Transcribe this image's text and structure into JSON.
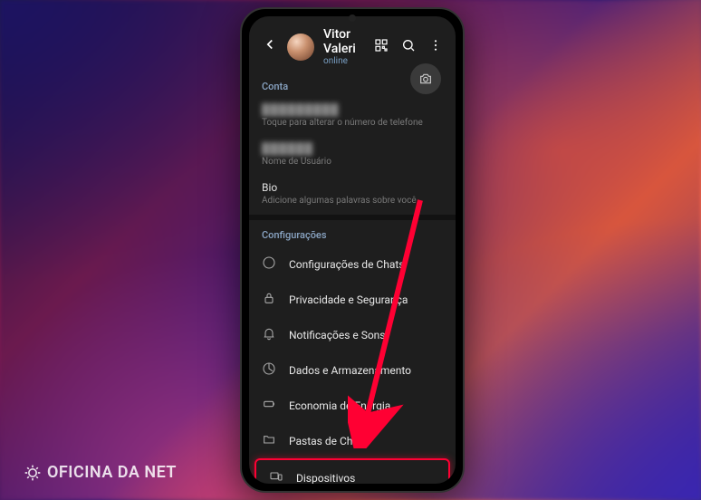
{
  "profile": {
    "name": "Vitor Valeri",
    "status": "online"
  },
  "account": {
    "header": "Conta",
    "phone_blurred": "█████████",
    "phone_sub": "Toque para alterar o número de telefone",
    "username_blurred": "██████",
    "username_sub": "Nome de Usuário",
    "bio_label": "Bio",
    "bio_sub": "Adicione algumas palavras sobre você"
  },
  "settings": {
    "header": "Configurações",
    "items": [
      {
        "label": "Configurações de Chats",
        "icon": "chat"
      },
      {
        "label": "Privacidade e Segurança",
        "icon": "lock"
      },
      {
        "label": "Notificações e Sons",
        "icon": "bell"
      },
      {
        "label": "Dados e Armazenamento",
        "icon": "data"
      },
      {
        "label": "Economia de Energia",
        "icon": "battery"
      },
      {
        "label": "Pastas de Chat",
        "icon": "folder"
      },
      {
        "label": "Dispositivos",
        "icon": "devices"
      }
    ]
  },
  "watermark": "OFICINA DA NET"
}
